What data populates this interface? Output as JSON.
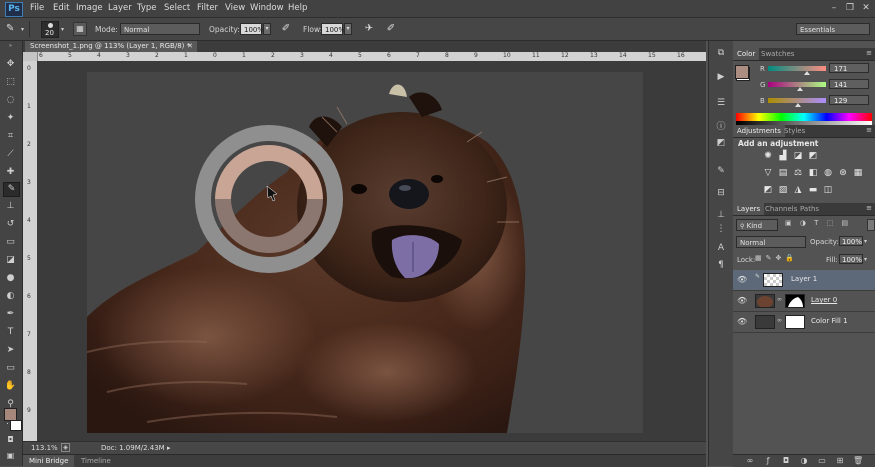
{
  "app": {
    "logo": "Ps"
  },
  "menu": [
    "File",
    "Edit",
    "Image",
    "Layer",
    "Type",
    "Select",
    "Filter",
    "View",
    "Window",
    "Help"
  ],
  "window_controls": [
    "–",
    "❐",
    "✕"
  ],
  "options": {
    "brush_size": "20",
    "mode_label": "Mode:",
    "mode_value": "Normal",
    "opacity_label": "Opacity:",
    "opacity_value": "100%",
    "flow_label": "Flow:",
    "flow_value": "100%",
    "workspace": "Essentials"
  },
  "document": {
    "tab_title": "Screenshot_1.png @ 113% (Layer 1, RGB/8) *",
    "zoom": "113.1%",
    "doc_size": "Doc: 1.09M/2.43M",
    "ruler_top": [
      "6",
      "5",
      "4",
      "3",
      "2",
      "1",
      "0",
      "1",
      "2",
      "3",
      "4",
      "5",
      "6",
      "7",
      "8",
      "9",
      "10",
      "11",
      "12",
      "13",
      "14",
      "15",
      "16"
    ],
    "ruler_left": [
      "0",
      "1",
      "2",
      "3",
      "4",
      "5",
      "6",
      "7",
      "8",
      "9"
    ]
  },
  "bottom_tabs": [
    "Mini Bridge",
    "Timeline"
  ],
  "color_panel": {
    "tabs": [
      "Color",
      "Swatches"
    ],
    "channels": [
      {
        "label": "R",
        "value": "171",
        "fraction": 0.67
      },
      {
        "label": "G",
        "value": "141",
        "fraction": 0.55
      },
      {
        "label": "B",
        "value": "129",
        "fraction": 0.51
      }
    ],
    "swatch_color": "#ab8d81"
  },
  "adjustments_panel": {
    "tabs": [
      "Adjustments",
      "Styles"
    ],
    "heading": "Add an adjustment",
    "icons_row1": [
      "brightness-contrast-icon",
      "levels-icon",
      "curves-icon",
      "exposure-icon"
    ],
    "icons_row2": [
      "vibrance-icon",
      "hue-saturation-icon",
      "color-balance-icon",
      "black-white-icon",
      "photo-filter-icon",
      "channel-mixer-icon",
      "color-lookup-icon"
    ],
    "icons_row3": [
      "invert-icon",
      "posterize-icon",
      "threshold-icon",
      "gradient-map-icon",
      "selective-color-icon"
    ]
  },
  "layers_panel": {
    "tabs": [
      "Layers",
      "Channels",
      "Paths"
    ],
    "kind_label": "Kind",
    "blend_mode": "Normal",
    "opacity_label": "Opacity:",
    "opacity_value": "100%",
    "lock_label": "Lock:",
    "fill_label": "Fill:",
    "fill_value": "100%",
    "layers": [
      {
        "name": "Layer 1",
        "selected": true
      },
      {
        "name": "Layer 0",
        "selected": false
      },
      {
        "name": "Color Fill 1",
        "selected": false
      }
    ]
  },
  "colors": {
    "fg": "#a6877b",
    "bg": "#ffffff",
    "ring_top": "#c9a595",
    "ring_bottom": "#8b7770",
    "ring_outer": "#8f8f8f"
  }
}
